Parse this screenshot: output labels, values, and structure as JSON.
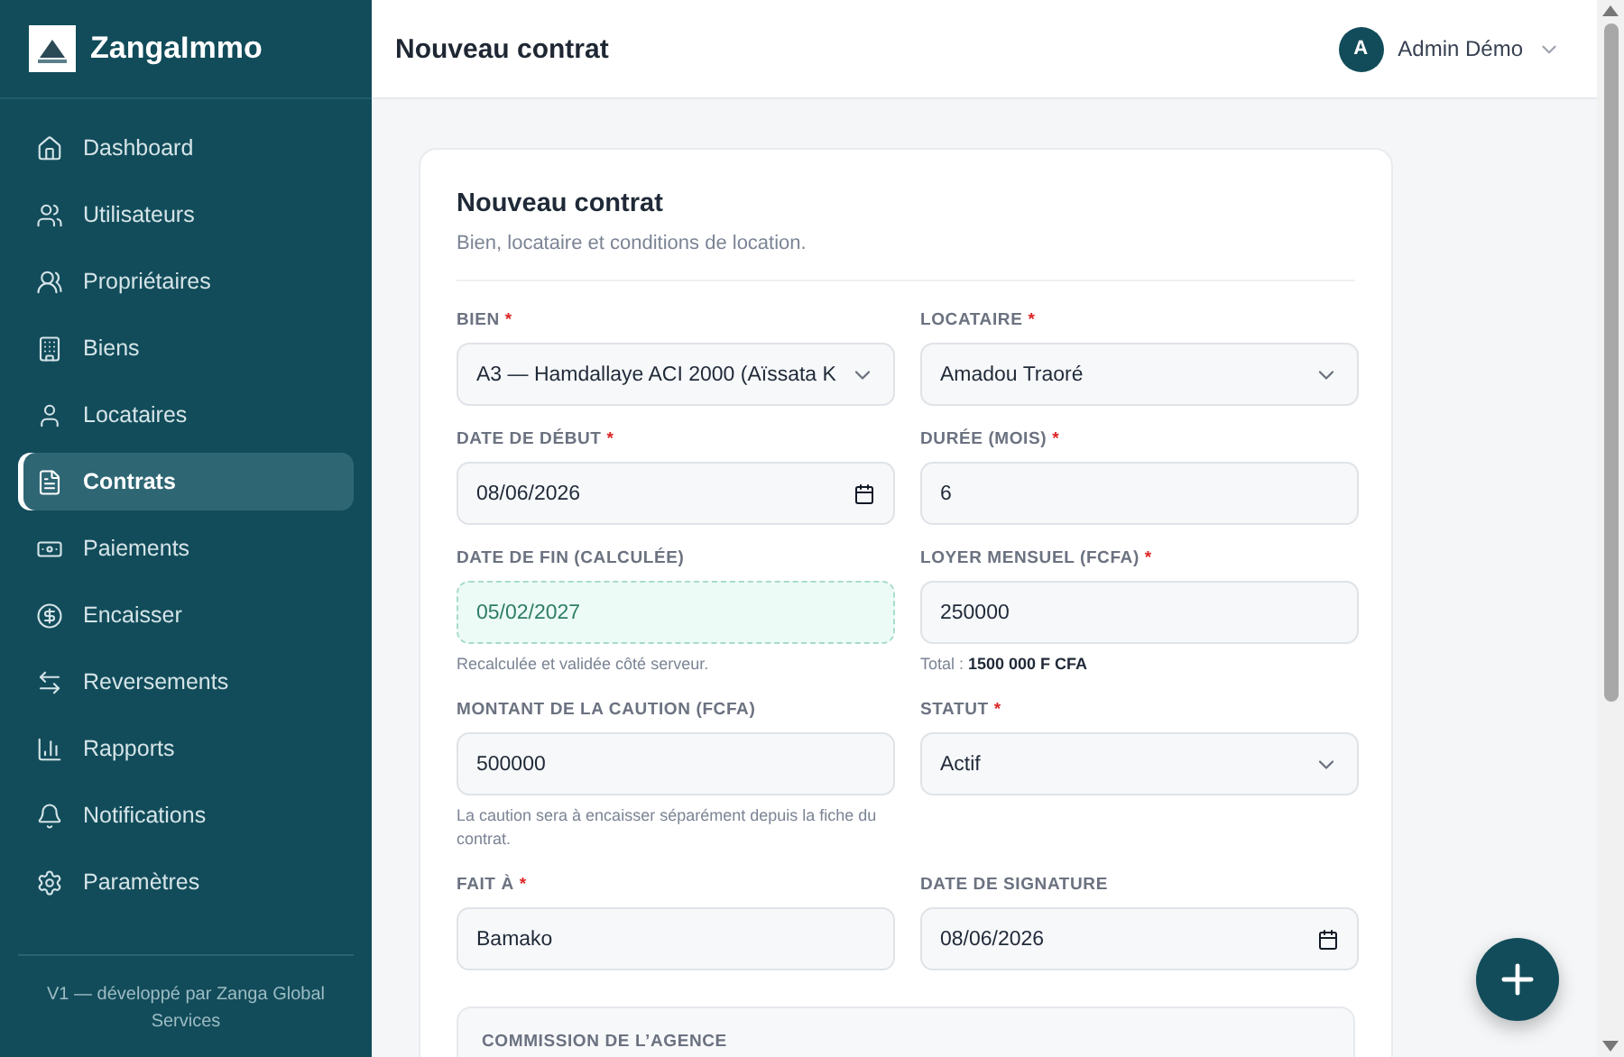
{
  "sidebar": {
    "brand": "ZangaImmo",
    "items": [
      {
        "label": "Dashboard",
        "selected": false
      },
      {
        "label": "Utilisateurs",
        "selected": false
      },
      {
        "label": "Propriétaires",
        "selected": false
      },
      {
        "label": "Biens",
        "selected": false
      },
      {
        "label": "Locataires",
        "selected": false
      },
      {
        "label": "Contrats",
        "selected": true
      },
      {
        "label": "Paiements",
        "selected": false
      },
      {
        "label": "Encaisser",
        "selected": false
      },
      {
        "label": "Reversements",
        "selected": false
      },
      {
        "label": "Rapports",
        "selected": false
      },
      {
        "label": "Notifications",
        "selected": false
      },
      {
        "label": "Paramètres",
        "selected": false
      }
    ],
    "footer": "V1 — développé par Zanga Global Services"
  },
  "header": {
    "title": "Nouveau contrat",
    "user": {
      "initial": "A",
      "name": "Admin Démo"
    }
  },
  "form": {
    "title": "Nouveau contrat",
    "subtitle": "Bien, locataire et conditions de location.",
    "fields": [
      {
        "kind": "select",
        "label": "BIEN",
        "required": "*",
        "value": "A3 — Hamdallaye ACI 2000 (Aïssata K"
      },
      {
        "kind": "select",
        "label": "LOCATAIRE",
        "required": "*",
        "value": "Amadou Traoré"
      },
      {
        "kind": "date",
        "label": "DATE DE DÉBUT",
        "required": "*",
        "value": "08/06/2026"
      },
      {
        "kind": "text",
        "label": "DURÉE (MOIS)",
        "required": "*",
        "value": "6"
      },
      {
        "kind": "computed",
        "label": "DATE DE FIN (CALCULÉE)",
        "value": "05/02/2027",
        "help": "Recalculée et validée côté serveur."
      },
      {
        "kind": "text",
        "label": "LOYER MENSUEL (FCFA)",
        "required": "*",
        "value": "250000",
        "help": "Total : **1500 000 F CFA**"
      },
      {
        "kind": "text",
        "label": "MONTANT DE LA CAUTION (FCFA)",
        "value": "500000",
        "help": "La caution sera à encaisser séparément depuis la fiche du contrat."
      },
      {
        "kind": "select",
        "label": "STATUT",
        "required": "*",
        "value": "Actif"
      },
      {
        "kind": "text",
        "label": "FAIT À",
        "required": "*",
        "value": "Bamako"
      },
      {
        "kind": "date",
        "label": "DATE DE SIGNATURE",
        "value": "08/06/2026"
      }
    ],
    "section": {
      "title": "COMMISSION DE L’AGENCE"
    }
  }
}
